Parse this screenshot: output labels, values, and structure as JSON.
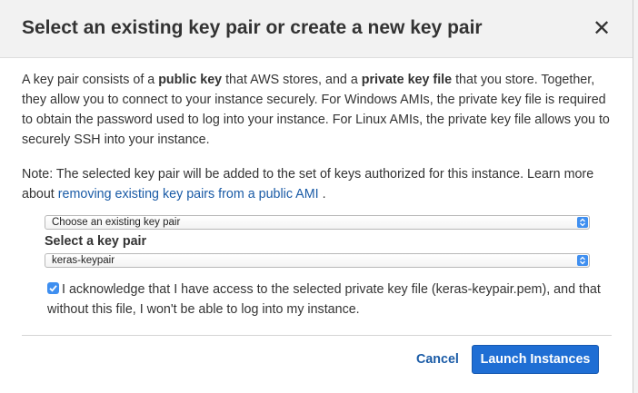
{
  "dialog": {
    "title": "Select an existing key pair or create a new key pair",
    "close_glyph": "✕",
    "intro": {
      "t1": "A key pair consists of a ",
      "b1": "public key",
      "t2": " that AWS stores, and a ",
      "b2": "private key file",
      "t3": " that you store. Together, they allow you to connect to your instance securely. For Windows AMIs, the private key file is required to obtain the password used to log into your instance. For Linux AMIs, the private key file allows you to securely SSH into your instance."
    },
    "note": {
      "t1": "Note: The selected key pair will be added to the set of keys authorized for this instance. Learn more about ",
      "link": "removing existing key pairs from a public AMI",
      "t2": " ."
    },
    "key_option_select": {
      "value": "Choose an existing key pair"
    },
    "key_pair_label": "Select a key pair",
    "key_pair_select": {
      "value": "keras-keypair"
    },
    "acknowledge": {
      "checked": true,
      "text": "I acknowledge that I have access to the selected private key file (keras-keypair.pem), and that without this file, I won't be able to log into my instance."
    },
    "cancel_label": "Cancel",
    "launch_label": "Launch Instances"
  },
  "colors": {
    "accent": "#1f6ed4",
    "link": "#1a5ba6",
    "header_bg": "#f2f2f2"
  },
  "icons": [
    "close-icon",
    "select-arrows-icon",
    "checkmark-icon"
  ]
}
